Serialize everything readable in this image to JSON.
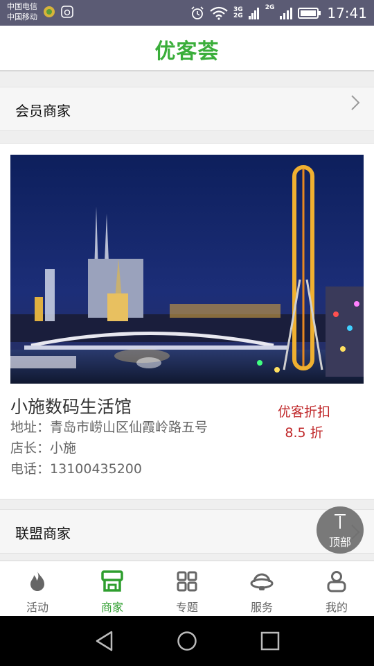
{
  "status_bar": {
    "carrier_1": "中国电信",
    "carrier_2": "中国移动",
    "net_3g": "3G",
    "net_2g_a": "2G",
    "net_2g_b": "2G",
    "time": "17:41",
    "icons": [
      "app-icon",
      "recorder-icon",
      "alarm-icon",
      "wifi-icon",
      "signal-icon",
      "signal-icon",
      "battery-icon"
    ]
  },
  "header": {
    "logo": "优客荟"
  },
  "member_section": {
    "title": "会员商家",
    "icon": "chevron-right-icon"
  },
  "shop_card": {
    "name": "小施数码生活馆",
    "address_label": "地址：",
    "address": "青岛市崂山区仙霞岭路五号",
    "manager_label": "店长：",
    "manager": "小施",
    "phone_label": "电话：",
    "phone": "13100435200",
    "discount_title": "优客折扣",
    "discount_value": "8.5 折"
  },
  "alliance_section": {
    "title": "联盟商家",
    "icon": "chevron-right-icon"
  },
  "top_button": {
    "label": "顶部",
    "icon": "arrow-up-icon"
  },
  "tab_bar": {
    "active_color": "#2e9e2e",
    "inactive_color": "#666666",
    "tabs": [
      {
        "label": "活动",
        "icon": "flame-icon"
      },
      {
        "label": "商家",
        "icon": "store-icon"
      },
      {
        "label": "专题",
        "icon": "grid-icon"
      },
      {
        "label": "服务",
        "icon": "headset-icon"
      },
      {
        "label": "我的",
        "icon": "person-icon"
      }
    ]
  },
  "system_nav": {
    "icons": [
      "back-icon",
      "home-icon",
      "recents-icon"
    ]
  },
  "colors": {
    "brand_green": "#3aae3a",
    "discount_red": "#c0282a",
    "status_bar": "#5b5b74"
  }
}
